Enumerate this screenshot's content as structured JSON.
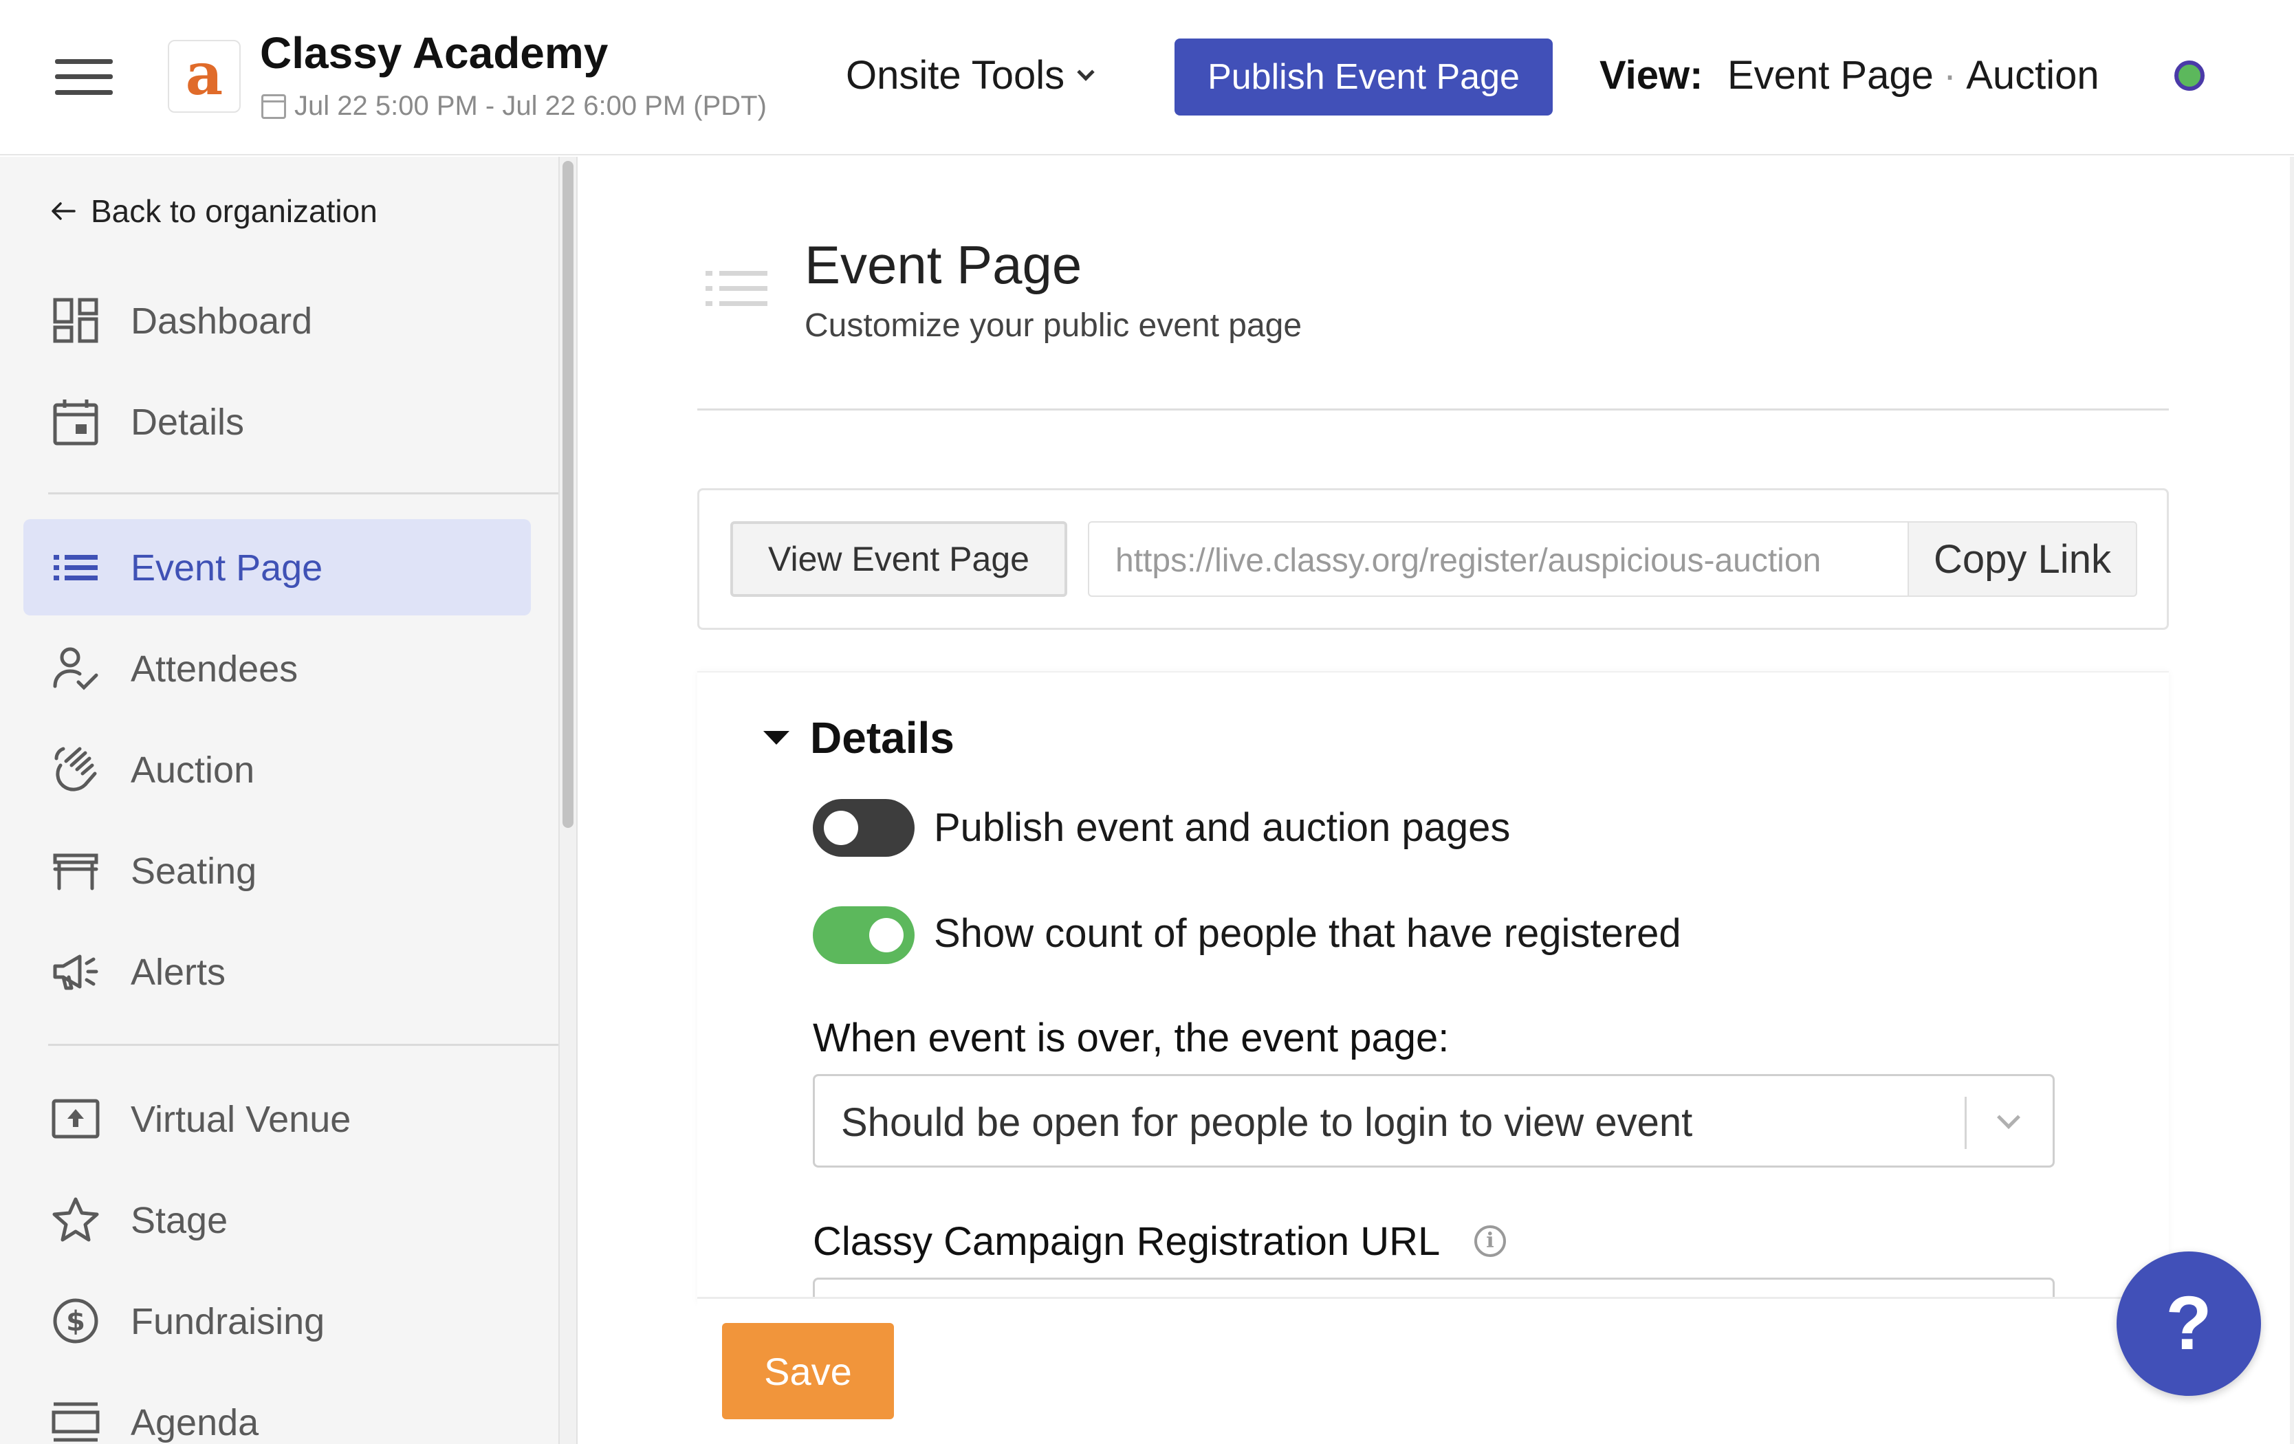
{
  "header": {
    "org_logo_letter": "a",
    "org_name": "Classy Academy",
    "event_date": "Jul 22 5:00 PM - Jul 22 6:00 PM (PDT)",
    "onsite_tools_label": "Onsite Tools",
    "publish_button_label": "Publish Event Page",
    "view_label": "View:",
    "view_option_1": "Event Page",
    "view_separator": "·",
    "view_option_2": "Auction",
    "status_dot_color": "#5cb85c"
  },
  "sidebar": {
    "back_label": "Back to organization",
    "items": [
      {
        "label": "Dashboard",
        "icon": "dashboard-icon"
      },
      {
        "label": "Details",
        "icon": "calendar-icon"
      },
      {
        "label": "Event Page",
        "icon": "list-icon",
        "active": true
      },
      {
        "label": "Attendees",
        "icon": "person-check-icon"
      },
      {
        "label": "Auction",
        "icon": "gavel-hand-icon"
      },
      {
        "label": "Seating",
        "icon": "table-icon"
      },
      {
        "label": "Alerts",
        "icon": "megaphone-icon"
      },
      {
        "label": "Virtual Venue",
        "icon": "upload-screen-icon"
      },
      {
        "label": "Stage",
        "icon": "star-icon"
      },
      {
        "label": "Fundraising",
        "icon": "dollar-circle-icon"
      },
      {
        "label": "Agenda",
        "icon": "agenda-icon"
      }
    ]
  },
  "main": {
    "title": "Event Page",
    "subtitle": "Customize your public event page",
    "view_event_page_label": "View Event Page",
    "event_url": "https://live.classy.org/register/auspicious-auction",
    "copy_link_label": "Copy Link",
    "details_section": {
      "title": "Details",
      "toggle_publish_label": "Publish event and auction pages",
      "toggle_publish_on": false,
      "toggle_count_label": "Show count of people that have registered",
      "toggle_count_on": true,
      "event_over_label": "When event is over, the event page:",
      "event_over_value": "Should be open for people to login to view event",
      "campaign_url_label": "Classy Campaign Registration URL"
    },
    "save_label": "Save",
    "help_label": "?"
  },
  "colors": {
    "brand_blue": "#4150b8",
    "active_nav_bg": "#dfe3f7",
    "toggle_on": "#5cb85c",
    "toggle_off": "#3d3d3d",
    "save_orange": "#f1953b"
  }
}
